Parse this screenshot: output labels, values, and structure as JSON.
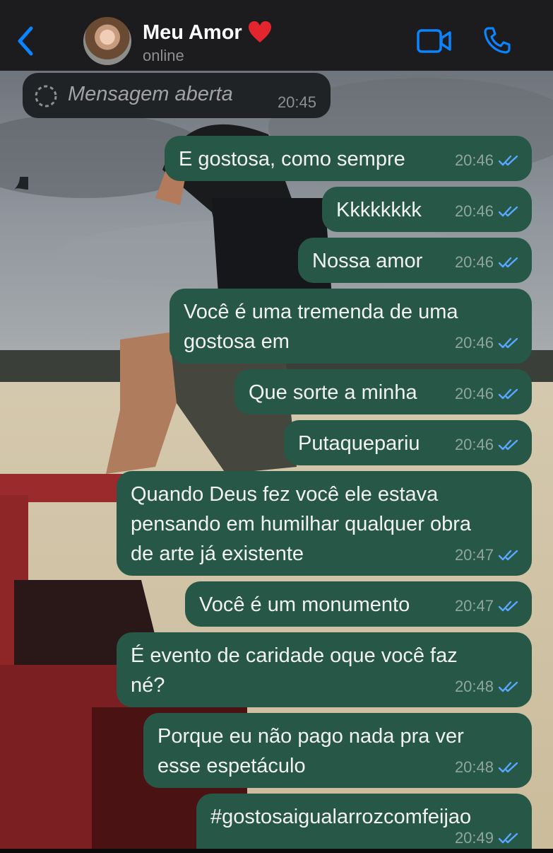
{
  "header": {
    "contact_name": "Meu Amor",
    "name_emoji": "heart-emoji",
    "status": "online",
    "accent_color": "#0a84ff"
  },
  "incoming_message": {
    "text": "Mensagem aberta",
    "time": "20:45",
    "icon": "view-once-icon"
  },
  "messages": [
    {
      "lines": [
        "E gostosa, como sempre"
      ],
      "time": "20:46",
      "status": "read"
    },
    {
      "lines": [
        "Kkkkkkkk"
      ],
      "time": "20:46",
      "status": "read"
    },
    {
      "lines": [
        "Nossa amor"
      ],
      "time": "20:46",
      "status": "read"
    },
    {
      "lines": [
        "Você é uma tremenda de uma",
        "gostosa em"
      ],
      "time": "20:46",
      "status": "read"
    },
    {
      "lines": [
        "Que sorte a minha"
      ],
      "time": "20:46",
      "status": "read"
    },
    {
      "lines": [
        "Putaquepariu"
      ],
      "time": "20:46",
      "status": "read"
    },
    {
      "lines": [
        "Quando Deus fez você ele estava",
        "pensando em humilhar qualquer obra",
        "de arte já existente"
      ],
      "time": "20:47",
      "status": "read"
    },
    {
      "lines": [
        "Você é um monumento"
      ],
      "time": "20:47",
      "status": "read"
    },
    {
      "lines": [
        "É evento de caridade oque você faz",
        "né?"
      ],
      "time": "20:48",
      "status": "read"
    },
    {
      "lines": [
        "Porque eu não pago nada pra ver",
        "esse espetáculo"
      ],
      "time": "20:48",
      "status": "read"
    },
    {
      "lines": [
        "#gostosaigualarrozcomfeijao"
      ],
      "time": "20:49",
      "status": "read"
    }
  ],
  "colors": {
    "outgoing_bubble": "#265747",
    "incoming_bubble": "#202325",
    "read_tick": "#5aa8ff",
    "header_bg": "#1c1c1e"
  }
}
